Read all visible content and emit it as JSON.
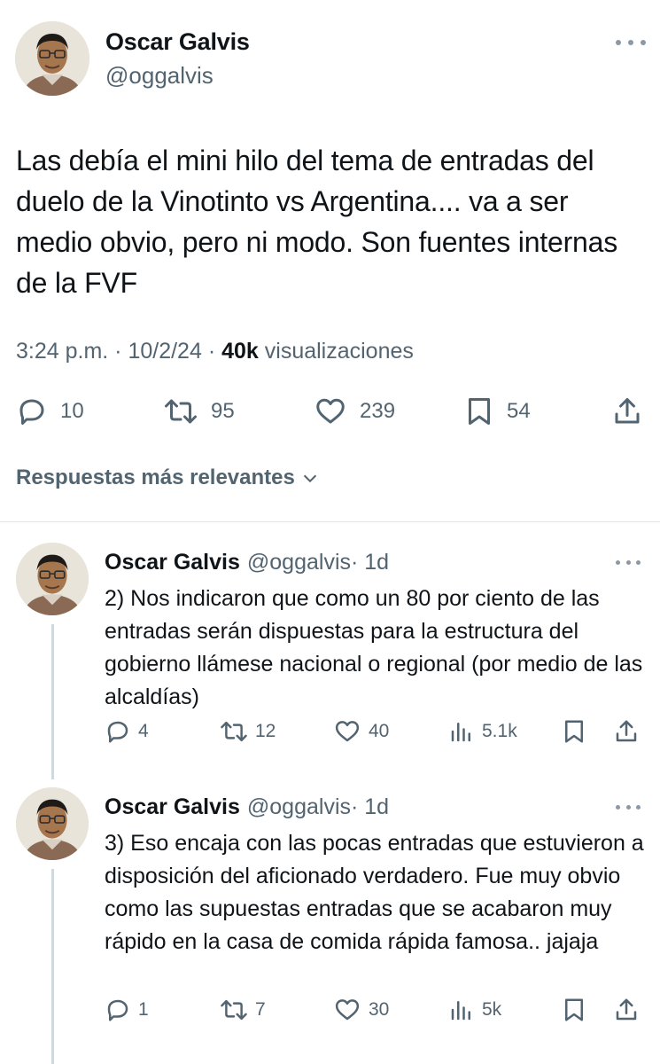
{
  "main_tweet": {
    "author_name": "Oscar Galvis",
    "author_handle": "@oggalvis",
    "text": "Las debía el mini hilo del tema de entradas del duelo de la Vinotinto vs Argentina.... va a ser medio obvio, pero ni modo. Son fuentes internas de la FVF",
    "time": "3:24 p.m.",
    "sep1": " · ",
    "date": "10/2/24",
    "sep2": " · ",
    "views_count": "40k",
    "views_label": " visualizaciones",
    "replies": "10",
    "reposts": "95",
    "likes": "239",
    "bookmarks": "54"
  },
  "sort_label": "Respuestas más relevantes",
  "replies": [
    {
      "author_name": "Oscar Galvis",
      "author_handle": "@oggalvis",
      "time": "· 1d",
      "text": "2) Nos indicaron que como un 80 por ciento de las entradas serán dispuestas para la estructura del gobierno llámese nacional o regional (por medio de las alcaldías)",
      "replies": "4",
      "reposts": "12",
      "likes": "40",
      "views": "5.1k"
    },
    {
      "author_name": "Oscar Galvis",
      "author_handle": "@oggalvis",
      "time": "· 1d",
      "text": "3) Eso encaja con las pocas entradas que estuvieron a disposición del aficionado verdadero. Fue muy obvio como las supuestas entradas que se acabaron muy rápido en la casa de comida rápida famosa.. jajaja",
      "replies": "1",
      "reposts": "7",
      "likes": "30",
      "views": "5k"
    }
  ],
  "colors": {
    "text": "#0f1419",
    "secondary": "#536471",
    "divider": "#e4e8eb"
  },
  "icons": [
    "reply-icon",
    "repost-icon",
    "like-icon",
    "bookmark-icon",
    "share-icon",
    "views-icon",
    "more-icon",
    "chevron-down-icon"
  ]
}
